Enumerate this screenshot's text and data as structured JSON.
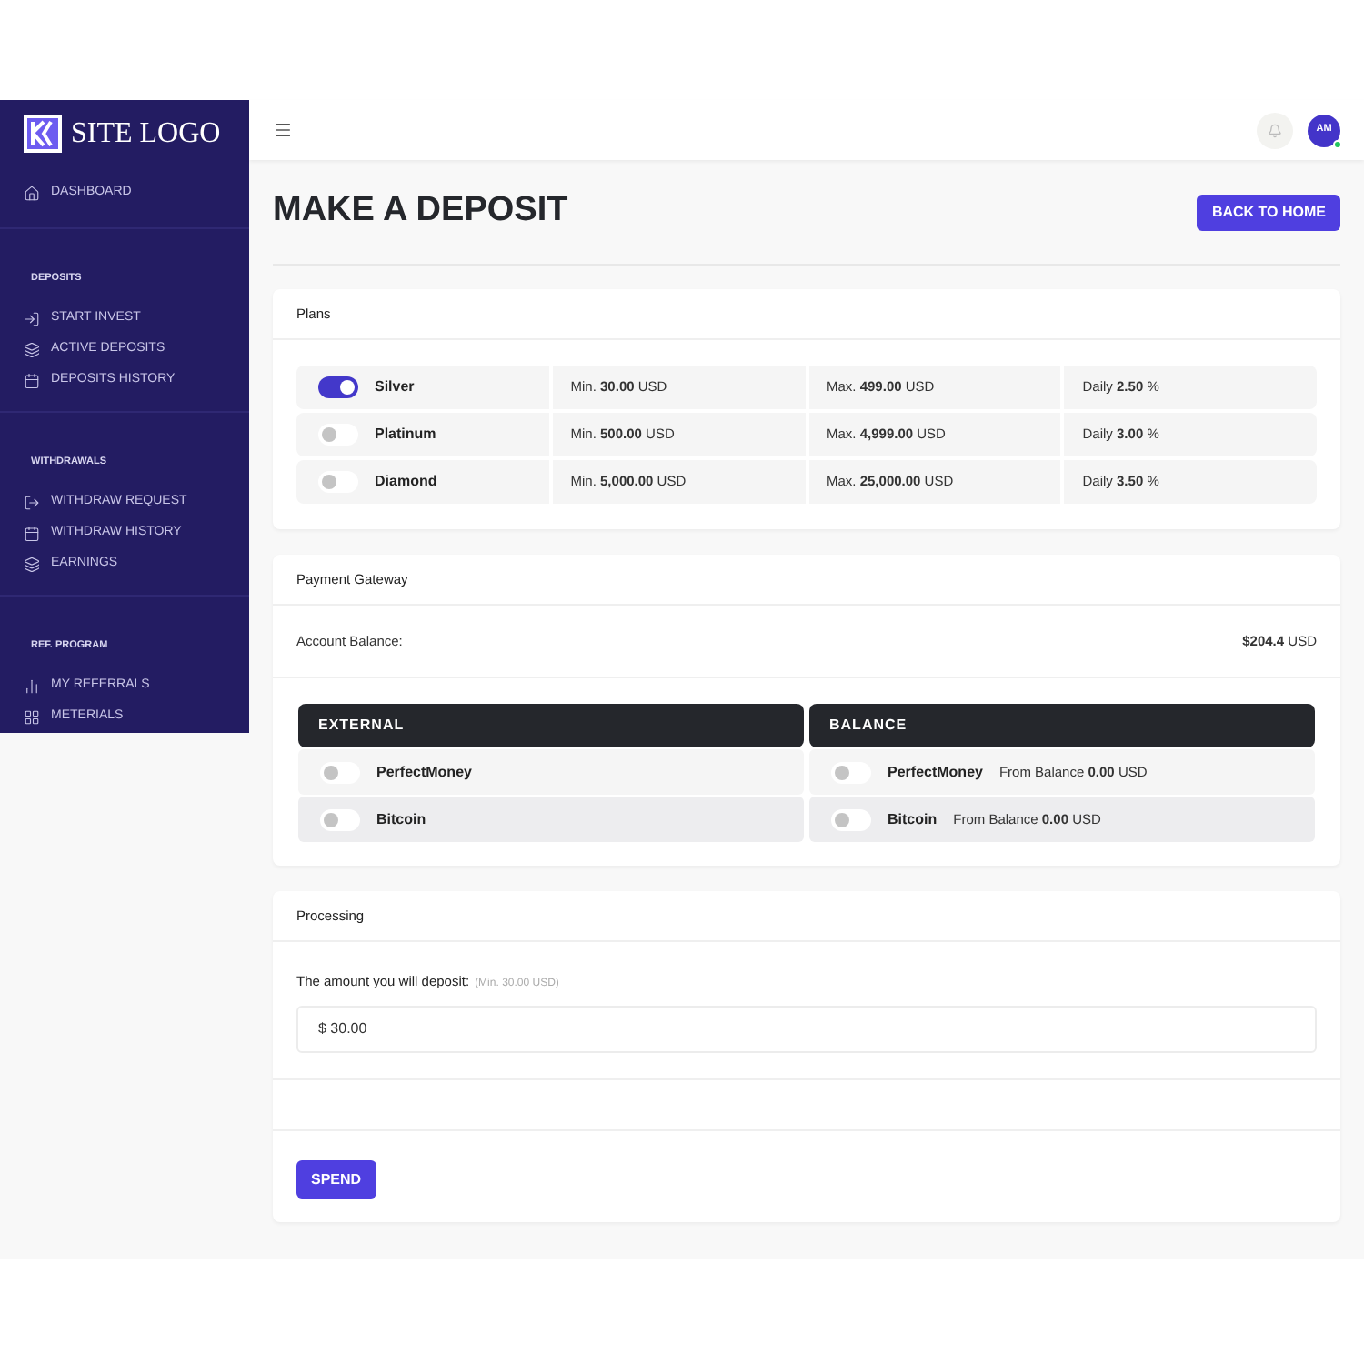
{
  "logo": {
    "text": "SITE LOGO"
  },
  "sidebar": {
    "items": [
      {
        "kind": "item",
        "label": "DASHBOARD"
      },
      {
        "kind": "section",
        "label": "DEPOSITS"
      },
      {
        "kind": "item",
        "label": "START INVEST"
      },
      {
        "kind": "item",
        "label": "ACTIVE DEPOSITS"
      },
      {
        "kind": "item",
        "label": "DEPOSITS HISTORY"
      },
      {
        "kind": "section",
        "label": "WITHDRAWALS"
      },
      {
        "kind": "item",
        "label": "WITHDRAW REQUEST"
      },
      {
        "kind": "item",
        "label": "WITHDRAW HISTORY"
      },
      {
        "kind": "item",
        "label": "EARNINGS"
      },
      {
        "kind": "section",
        "label": "REF. PROGRAM"
      },
      {
        "kind": "item",
        "label": "MY REFERRALS"
      },
      {
        "kind": "item",
        "label": "METERIALS"
      }
    ]
  },
  "topbar": {
    "avatar": "AM",
    "online": true
  },
  "page_title": "MAKE A DEPOSIT",
  "back_button": "BACK TO HOME",
  "plans": {
    "title": "Plans",
    "rows": [
      {
        "name": "Silver",
        "selected": true,
        "min": "Min. **30.00** USD",
        "max": "Max. **499.00** USD",
        "daily": "Daily **2.50** %"
      },
      {
        "name": "Platinum",
        "selected": false,
        "min": "Min. **500.00** USD",
        "max": "Max. **4,999.00** USD",
        "daily": "Daily **3.00** %"
      },
      {
        "name": "Diamond",
        "selected": false,
        "min": "Min. **5,000.00** USD",
        "max": "Max. **25,000.00** USD",
        "daily": "Daily **3.50** %"
      }
    ]
  },
  "payment": {
    "title": "Payment Gateway",
    "balance_label": "Account Balance:",
    "balance_value": "**$204.4** USD",
    "columns": [
      {
        "heading": "EXTERNAL",
        "options": [
          {
            "name": "PerfectMoney",
            "selected": false
          },
          {
            "name": "Bitcoin",
            "selected": false
          }
        ]
      },
      {
        "heading": "BALANCE",
        "options": [
          {
            "name": "PerfectMoney",
            "note": "From Balance **0.00** USD",
            "selected": false
          },
          {
            "name": "Bitcoin",
            "note": "From Balance **0.00** USD",
            "selected": false
          }
        ]
      }
    ]
  },
  "processing": {
    "title": "Processing",
    "amount_label": "The amount you will deposit:",
    "amount_hint": "(Min. 30.00 USD)",
    "amount_value": "$ 30.00",
    "submit": "SPEND"
  }
}
